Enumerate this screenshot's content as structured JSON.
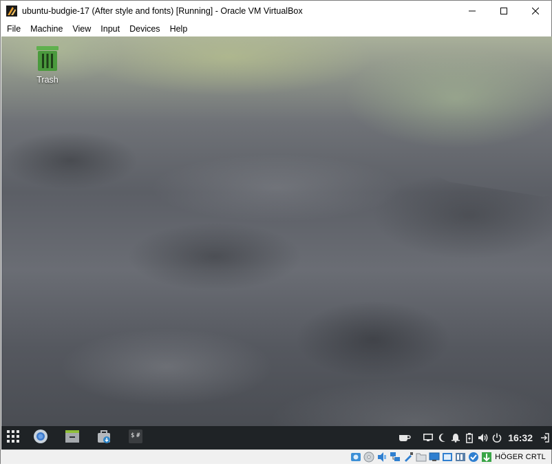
{
  "window": {
    "title": "ubuntu-budgie-17 (After style and fonts) [Running] - Oracle VM VirtualBox",
    "app_icon": "virtualbox-icon",
    "controls": [
      "minimize-icon",
      "maximize-icon",
      "close-icon"
    ]
  },
  "menu": {
    "items": [
      {
        "label": "File"
      },
      {
        "label": "Machine"
      },
      {
        "label": "View"
      },
      {
        "label": "Input"
      },
      {
        "label": "Devices"
      },
      {
        "label": "Help"
      }
    ]
  },
  "desktop": {
    "icons": [
      {
        "label": "Trash",
        "icon": "trash-icon"
      }
    ]
  },
  "panel": {
    "launchers": [
      {
        "name": "app-menu",
        "icon": "grid-icon"
      },
      {
        "name": "chromium",
        "icon": "browser-icon"
      },
      {
        "name": "file-manager",
        "icon": "files-icon"
      },
      {
        "name": "software",
        "icon": "store-icon"
      },
      {
        "name": "terminal",
        "icon": "terminal-icon"
      }
    ],
    "tray": [
      "cup-icon",
      "display-icon",
      "moon-icon",
      "bell-icon",
      "battery-icon",
      "volume-icon",
      "power-icon"
    ],
    "clock": "16:32",
    "logout_icon": "logout-icon"
  },
  "statusbar": {
    "icons": [
      "hard-disk-icon",
      "optical-drive-icon",
      "audio-icon",
      "network-icon",
      "usb-icon",
      "shared-folders-icon",
      "display-icon",
      "video-capture-icon",
      "recording-icon",
      "cpu-icon",
      "mouse-integration-icon"
    ],
    "host_key": "HÖGER CRTL"
  },
  "colors": {
    "panel_bg": "#1f2326",
    "trash_green": "#4a9a3d",
    "statusbar_bg": "#f0f0f0"
  }
}
